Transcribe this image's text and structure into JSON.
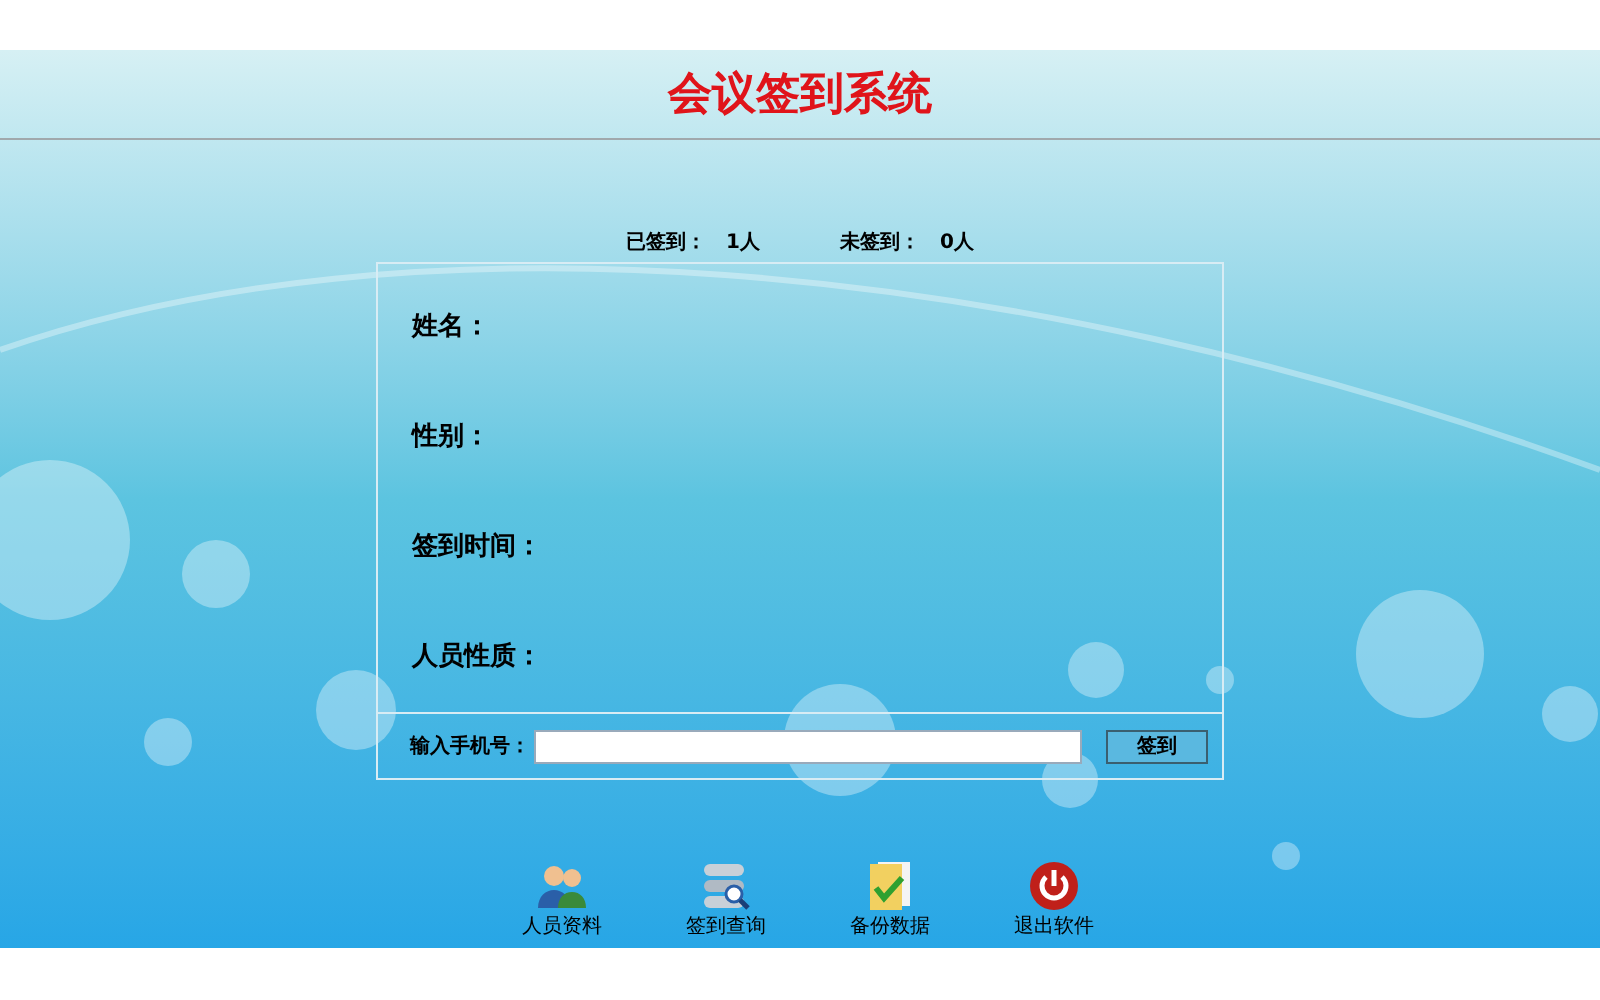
{
  "title": "会议签到系统",
  "stats": [
    {
      "label": "已签到：",
      "value": "1人"
    },
    {
      "label": "未签到：",
      "value": "0人"
    }
  ],
  "fields": [
    {
      "label": "姓名："
    },
    {
      "label": "性别："
    },
    {
      "label": "签到时间："
    },
    {
      "label": "人员性质："
    }
  ],
  "phone_input": {
    "label": "输入手机号："
  },
  "submit_button": "签到",
  "toolbar": [
    {
      "kind": "people",
      "label": "人员资料"
    },
    {
      "kind": "query",
      "label": "签到查询"
    },
    {
      "kind": "backup",
      "label": "备份数据"
    },
    {
      "kind": "exit",
      "label": "退出软件"
    }
  ]
}
